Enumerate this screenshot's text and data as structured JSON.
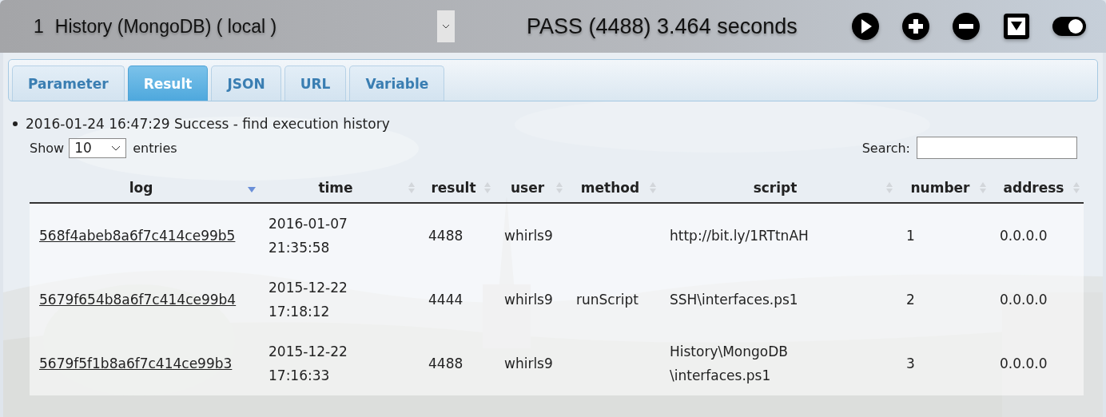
{
  "header": {
    "index": "1",
    "title": "History (MongoDB) ( local )",
    "status": "PASS (4488) 3.464 seconds",
    "toggle_on": true
  },
  "tabs": [
    {
      "label": "Parameter",
      "selected": false
    },
    {
      "label": "Result",
      "selected": true
    },
    {
      "label": "JSON",
      "selected": false
    },
    {
      "label": "URL",
      "selected": false
    },
    {
      "label": "Variable",
      "selected": false
    }
  ],
  "message": "2016-01-24 16:47:29 Success - find execution history",
  "length_menu": {
    "before": "Show",
    "value": "10",
    "after": "entries"
  },
  "search": {
    "label": "Search:"
  },
  "table": {
    "columns": [
      {
        "label": "log",
        "sorted": true
      },
      {
        "label": "time",
        "sorted": false
      },
      {
        "label": "result",
        "sorted": false
      },
      {
        "label": "user",
        "sorted": false
      },
      {
        "label": "method",
        "sorted": false
      },
      {
        "label": "script",
        "sorted": false
      },
      {
        "label": "number",
        "sorted": false
      },
      {
        "label": "address",
        "sorted": false
      }
    ],
    "rows": [
      {
        "log": "568f4abeb8a6f7c414ce99b5",
        "time": [
          "2016-01-07",
          "21:35:58"
        ],
        "result": "4488",
        "user": "whirls9",
        "method": "",
        "script": [
          "http://bit.ly/1RTtnAH"
        ],
        "number": "1",
        "address": "0.0.0.0"
      },
      {
        "log": "5679f654b8a6f7c414ce99b4",
        "time": [
          "2015-12-22",
          "17:18:12"
        ],
        "result": "4444",
        "user": "whirls9",
        "method": "runScript",
        "script": [
          "SSH\\interfaces.ps1"
        ],
        "number": "2",
        "address": "0.0.0.0"
      },
      {
        "log": "5679f5f1b8a6f7c414ce99b3",
        "time": [
          "2015-12-22",
          "17:16:33"
        ],
        "result": "4488",
        "user": "whirls9",
        "method": "",
        "script": [
          "History\\MongoDB",
          "\\interfaces.ps1"
        ],
        "number": "3",
        "address": "0.0.0.0"
      }
    ]
  }
}
